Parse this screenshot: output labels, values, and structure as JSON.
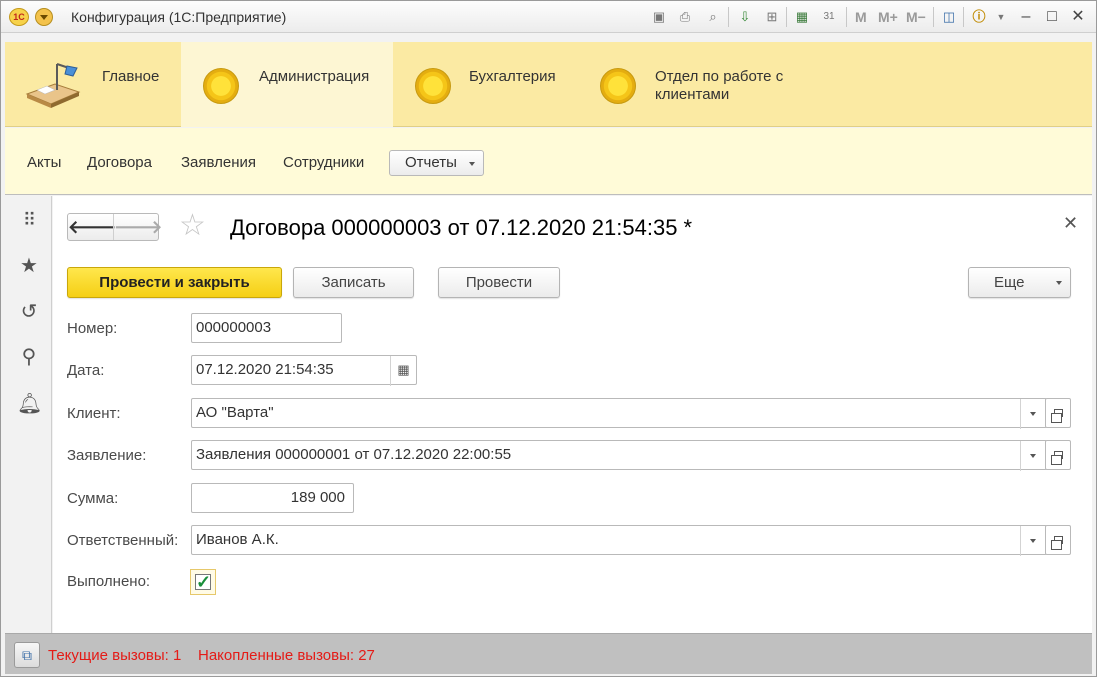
{
  "window": {
    "title": "Конфигурация  (1С:Предприятие)",
    "logo_text": "1С"
  },
  "toolbar": {
    "icons": [
      "save-icon",
      "print-icon",
      "preview-icon",
      "attach-icon",
      "link-icon",
      "calculator-icon",
      "calendar-icon"
    ],
    "m_labels": [
      "M",
      "M+",
      "M−"
    ]
  },
  "sections": [
    {
      "label": "Главное",
      "icon": "desk-lamp-icon",
      "active": false
    },
    {
      "label": "Администрация",
      "icon": "coin-icon",
      "active": true
    },
    {
      "label": "Бухгалтерия",
      "icon": "coin-icon",
      "active": false
    },
    {
      "label": "Отдел по работе с клиентами",
      "icon": "coin-icon",
      "active": false
    }
  ],
  "function_panel": {
    "links": [
      "Акты",
      "Договора",
      "Заявления",
      "Сотрудники"
    ],
    "reports_label": "Отчеты"
  },
  "form": {
    "title": "Договора 000000003 от 07.12.2020 21:54:35 *",
    "buttons": {
      "post_and_close": "Провести и закрыть",
      "write": "Записать",
      "post": "Провести",
      "more": "Еще"
    },
    "fields": {
      "number": {
        "label": "Номер:",
        "value": "000000003"
      },
      "date": {
        "label": "Дата:",
        "value": "07.12.2020 21:54:35"
      },
      "client": {
        "label": "Клиент:",
        "value": "АО \"Варта\""
      },
      "application": {
        "label": "Заявление:",
        "value": "Заявления 000000001 от 07.12.2020 22:00:55"
      },
      "amount": {
        "label": "Сумма:",
        "value": "189 000"
      },
      "responsible": {
        "label": "Ответственный:",
        "value": "Иванов А.К."
      },
      "done": {
        "label": "Выполнено:",
        "checked": true
      }
    }
  },
  "status": {
    "current_calls": "Текущие вызовы: 1",
    "accumulated_calls": "Накопленные вызовы: 27",
    "text_color": "#e41b17"
  },
  "colors": {
    "sections_bg": "#fbeaa3",
    "function_panel_bg": "#fffbd8",
    "primary_button": "#f5cf14"
  }
}
